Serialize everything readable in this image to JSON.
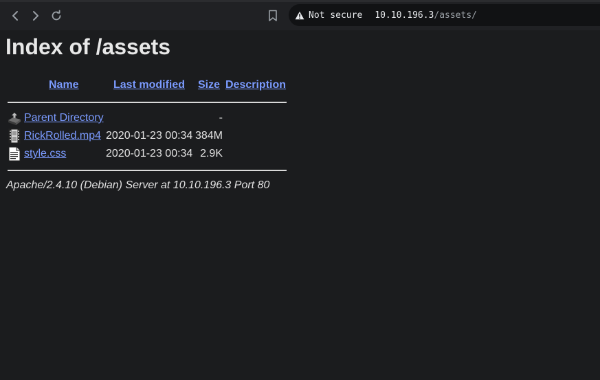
{
  "browser": {
    "security_label": "Not secure",
    "url_host": "10.10.196.3",
    "url_path": "/assets/",
    "icons": {
      "back": "back-arrow-icon",
      "forward": "forward-arrow-icon",
      "reload": "reload-icon",
      "bookmark": "bookmark-icon",
      "security": "warning-triangle-icon"
    }
  },
  "page": {
    "title": "Index of /assets",
    "columns": {
      "name": "Name",
      "last_modified": "Last modified",
      "size": "Size",
      "description": "Description"
    },
    "rows": [
      {
        "icon": "parent-directory-icon",
        "name": "Parent Directory",
        "modified": "",
        "size": "-"
      },
      {
        "icon": "movie-file-icon",
        "name": "RickRolled.mp4",
        "modified": "2020-01-23 00:34",
        "size": "384M"
      },
      {
        "icon": "text-file-icon",
        "name": "style.css",
        "modified": "2020-01-23 00:34",
        "size": "2.9K"
      }
    ],
    "server_signature": "Apache/2.4.10 (Debian) Server at 10.10.196.3 Port 80"
  },
  "colors": {
    "page_background": "#1b1c1e",
    "toolbar_background": "#202124",
    "link": "#7b9bff",
    "text": "#e3e3e3"
  }
}
